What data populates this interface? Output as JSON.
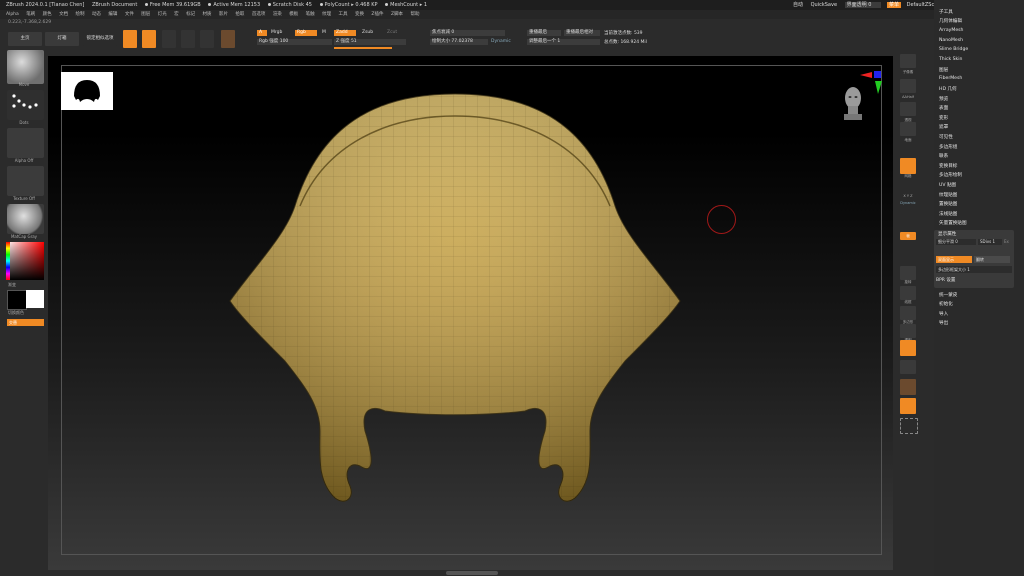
{
  "titlebar": {
    "app": "ZBrush 2024.0.1 [Tianao Chen]",
    "doc": "ZBrush Document",
    "free_mem": "Free Mem 39.619GB",
    "active_mem": "Active Mem 12153",
    "scratch": "Scratch Disk 45",
    "polycount": "PolyCount ▸ 0.468 KP",
    "meshcount": "MeshCount ▸ 1",
    "right_items": [
      "自动",
      "QuickSave",
      "界面透明 0",
      "菜单",
      "DefaultZScript"
    ]
  },
  "menubar": [
    "Alpha",
    "笔刷",
    "颜色",
    "文档",
    "绘制",
    "动态",
    "编辑",
    "文件",
    "图层",
    "灯光",
    "宏",
    "标记",
    "材质",
    "影片",
    "拾取",
    "首选项",
    "渲染",
    "模板",
    "笔触",
    "纹理",
    "工具",
    "变换",
    "Z插件",
    "Z脚本",
    "帮助"
  ],
  "coords": "0.223,-7.368,2.629",
  "toolbar": {
    "left_buttons": [
      "主页",
      "灯箱",
      "透视点"
    ],
    "sub_label": "锁定相似选项",
    "a_label": "A",
    "mrgb": "Mrgb",
    "rgb": "Rgb",
    "m": "M",
    "zadd": "Zadd",
    "zsub": "Zsub",
    "zcut": "Zcut",
    "rgb_intensity": "Rgb 强度 100",
    "z_intensity": "Z 强度 51",
    "focal_shift": "焦点衰减 0",
    "draw_size": "绘制大小 77.02378",
    "dynamic": "Dynamic",
    "replay_last": "重播最后",
    "replay_rel": "重播最后相对",
    "adjust_last": "调整最后一个 1",
    "active_points": "当前激活点数: 539",
    "total_points": "总点数: 168.924 Mil"
  },
  "leftshelf": {
    "brush_label": "Move",
    "stroke_label": "Dots",
    "alpha_label": "Alpha Off",
    "texture_label": "Texture Off",
    "material_label": "MatCap Gray",
    "color_label": "渐变",
    "switch_label": "切换颜色",
    "alt_label": "交替"
  },
  "rightshelf": [
    "子像素",
    "AAHalf",
    "透视",
    "地面",
    "网格",
    "X Y Z",
    "Dynamic",
    "帧",
    "移动",
    "缩放",
    "旋转",
    "线框",
    "多边形",
    "透明",
    "Ghost",
    "Solo",
    "Xpose"
  ],
  "toolpanel": {
    "items": [
      "子工具",
      "几何体编辑",
      "ArrayMesh",
      "NanoMesh",
      "Slime Bridge",
      "Thick Skin",
      "图层",
      "FiberMesh",
      "HD 几何",
      "预览",
      "表面",
      "变形",
      "遮罩",
      "可见性",
      "多边形组",
      "联系",
      "变换目标",
      "多边形绘制",
      "UV 贴图",
      "纹理贴图",
      "置换贴图",
      "法线贴图",
      "矢量置换贴图",
      "显示属性"
    ],
    "sub": {
      "smooth_label": "细分平滑 0",
      "sdiv_label": "SDivs 1",
      "edge_label": "Ex",
      "double_label": "双面显示",
      "flip_label": "翻转",
      "poly_size": "多边形框架大小 1",
      "bpr_label": "BPR 设置"
    },
    "bottom_items": [
      "统一蒙皮",
      "初始化",
      "导入",
      "导出"
    ]
  },
  "colors": {
    "accent": "#f08a24",
    "mesh": "#c4a24a"
  }
}
